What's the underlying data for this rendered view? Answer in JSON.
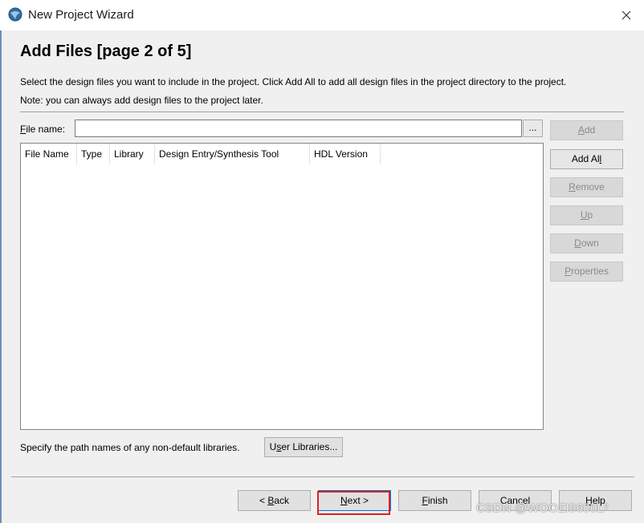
{
  "window": {
    "title": "New Project Wizard",
    "app_icon": "quartus-globe-icon",
    "close_icon": "close-icon"
  },
  "page": {
    "title": "Add Files [page 2 of 5]",
    "description": "Select the design files you want to include in the project. Click Add All to add all design files in the project directory to the project.",
    "note": "Note: you can always add design files to the project later."
  },
  "file_name": {
    "label": "File name:",
    "value": "",
    "browse_label": "..."
  },
  "table": {
    "columns": [
      "File Name",
      "Type",
      "Library",
      "Design Entry/Synthesis Tool",
      "HDL Version"
    ],
    "rows": []
  },
  "side_buttons": [
    {
      "label": "Add",
      "enabled": false
    },
    {
      "label": "Add All",
      "enabled": true
    },
    {
      "label": "Remove",
      "enabled": false
    },
    {
      "label": "Up",
      "enabled": false
    },
    {
      "label": "Down",
      "enabled": false
    },
    {
      "label": "Properties",
      "enabled": false
    }
  ],
  "libraries": {
    "text": "Specify the path names of any non-default libraries.",
    "button_label": "User Libraries..."
  },
  "nav_buttons": {
    "back": "< Back",
    "next": "Next >",
    "finish": "Finish",
    "cancel": "Cancel",
    "help": "Help"
  },
  "watermark": "CSDN @WOOZI9600L²",
  "colors": {
    "highlight": "#e02020",
    "focus": "#0078d7"
  }
}
